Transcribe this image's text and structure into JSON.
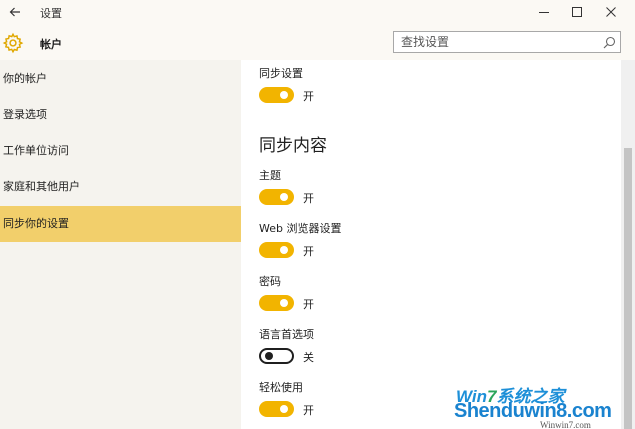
{
  "window": {
    "title": "设置",
    "back_icon": "arrow-left-icon",
    "controls": [
      "minimize-icon",
      "maximize-icon",
      "close-icon"
    ]
  },
  "header": {
    "icon": "gear-icon",
    "title": "帐户",
    "search_placeholder": "查找设置",
    "search_icon": "search-icon"
  },
  "sidebar": {
    "items": [
      {
        "label": "你的帐户",
        "selected": false
      },
      {
        "label": "登录选项",
        "selected": false
      },
      {
        "label": "工作单位访问",
        "selected": false
      },
      {
        "label": "家庭和其他用户",
        "selected": false
      },
      {
        "label": "同步你的设置",
        "selected": true
      }
    ]
  },
  "content": {
    "sync_settings": {
      "label": "同步设置",
      "state": "开",
      "on": true
    },
    "section_heading": "同步内容",
    "items": [
      {
        "label": "主题",
        "state": "开",
        "on": true
      },
      {
        "label": "Web 浏览器设置",
        "state": "开",
        "on": true
      },
      {
        "label": "密码",
        "state": "开",
        "on": true
      },
      {
        "label": "语言首选项",
        "state": "关",
        "on": false
      },
      {
        "label": "轻松使用",
        "state": "开",
        "on": true
      }
    ]
  },
  "colors": {
    "accent": "#f2b400",
    "selected_nav": "#f2cf6b",
    "sidebar_bg": "#f5f3ee"
  },
  "watermark": {
    "line1_prefix": "Win",
    "line1_seven": "7",
    "line1_suffix": "系统之家",
    "line2": "Shenduwin8.com",
    "line3": "Winwin7.com"
  }
}
